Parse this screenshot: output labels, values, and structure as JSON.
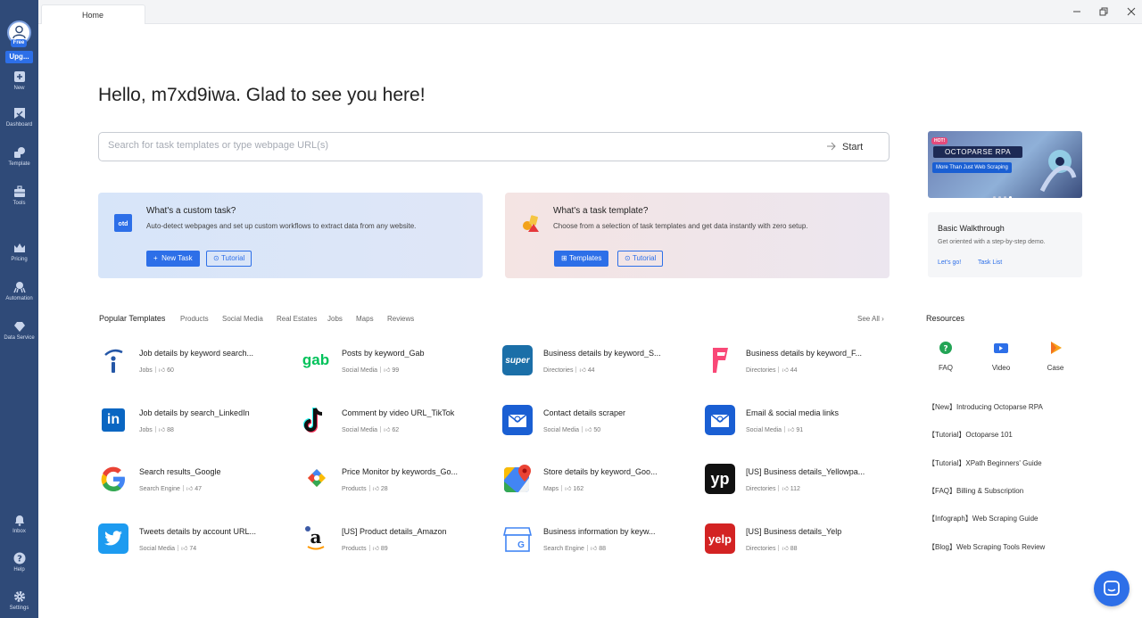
{
  "sidebar": {
    "free_badge": "Free",
    "upgrade_label": "Upg...",
    "items": [
      {
        "label": "New"
      },
      {
        "label": "Dashboard"
      },
      {
        "label": "Template"
      },
      {
        "label": "Tools"
      },
      {
        "label": "Pricing"
      },
      {
        "label": "Automation"
      },
      {
        "label": "Data Service"
      },
      {
        "label": "Inbox"
      },
      {
        "label": "Help"
      },
      {
        "label": "Settings"
      }
    ]
  },
  "tabs": [
    {
      "label": "Home"
    }
  ],
  "greeting": "Hello, m7xd9iwa. Glad to see you here!",
  "search": {
    "placeholder": "Search for task templates or type webpage URL(s)",
    "start_label": "Start"
  },
  "cards": {
    "custom": {
      "title": "What's a custom task?",
      "desc": "Auto-detect webpages and set up custom workflows to extract data from any website.",
      "primary_label": "New Task",
      "tutorial_label": "Tutorial",
      "icon_text": "otd"
    },
    "template": {
      "title": "What's a task template?",
      "desc": "Choose from a selection of task templates and get data instantly with zero setup.",
      "primary_label": "Templates",
      "tutorial_label": "Tutorial"
    }
  },
  "promo": {
    "hot": "HOT!",
    "title": "OCTOPARSE RPA",
    "subtitle": "More Than Just Web Scraping"
  },
  "walkthrough": {
    "title": "Basic Walkthrough",
    "desc": "Get oriented with a step-by-step demo.",
    "lets_go": "Let's go!",
    "task_list": "Task List"
  },
  "templates_tabs": [
    "Popular Templates",
    "Products",
    "Social Media",
    "Real Estates",
    "Jobs",
    "Maps",
    "Reviews"
  ],
  "see_all": "See All",
  "templates": [
    {
      "name": "Job details by keyword search...",
      "category": "Jobs",
      "likes": "60"
    },
    {
      "name": "Posts by keyword_Gab",
      "category": "Social Media",
      "likes": "99"
    },
    {
      "name": "Business details by keyword_S...",
      "category": "Directories",
      "likes": "44"
    },
    {
      "name": "Business details by keyword_F...",
      "category": "Directories",
      "likes": "44"
    },
    {
      "name": "Job details by search_LinkedIn",
      "category": "Jobs",
      "likes": "88"
    },
    {
      "name": "Comment by video URL_TikTok",
      "category": "Social Media",
      "likes": "62"
    },
    {
      "name": "Contact details scraper",
      "category": "Social Media",
      "likes": "50"
    },
    {
      "name": "Email & social media links",
      "category": "Social Media",
      "likes": "91"
    },
    {
      "name": "Search results_Google",
      "category": "Search Engine",
      "likes": "47"
    },
    {
      "name": "Price Monitor by keywords_Go...",
      "category": "Products",
      "likes": "28"
    },
    {
      "name": "Store details by keyword_Goo...",
      "category": "Maps",
      "likes": "162"
    },
    {
      "name": "[US] Business details_Yellowpa...",
      "category": "Directories",
      "likes": "112"
    },
    {
      "name": "Tweets details by account URL...",
      "category": "Social Media",
      "likes": "74"
    },
    {
      "name": "[US] Product details_Amazon",
      "category": "Products",
      "likes": "89"
    },
    {
      "name": "Business information by keyw...",
      "category": "Search Engine",
      "likes": "88"
    },
    {
      "name": "[US] Business details_Yelp",
      "category": "Directories",
      "likes": "88"
    }
  ],
  "template_icon_text": {
    "gab": "gab",
    "super": "super",
    "yp": "yp",
    "yelp": "yelp",
    "amazon": "a",
    "linkedin": "in"
  },
  "resources": {
    "title": "Resources",
    "icons": [
      {
        "label": "FAQ"
      },
      {
        "label": "Video"
      },
      {
        "label": "Case"
      }
    ],
    "links": [
      "【New】Introducing Octoparse RPA",
      "【Tutorial】Octoparse 101",
      "【Tutorial】XPath Beginners' Guide",
      "【FAQ】Billing & Subscription",
      "【Infograph】Web Scraping Guide",
      "【Blog】Web Scraping Tools Review"
    ]
  },
  "colors": {
    "sidebar": "#2f4a78",
    "accent": "#2d6fe8"
  }
}
